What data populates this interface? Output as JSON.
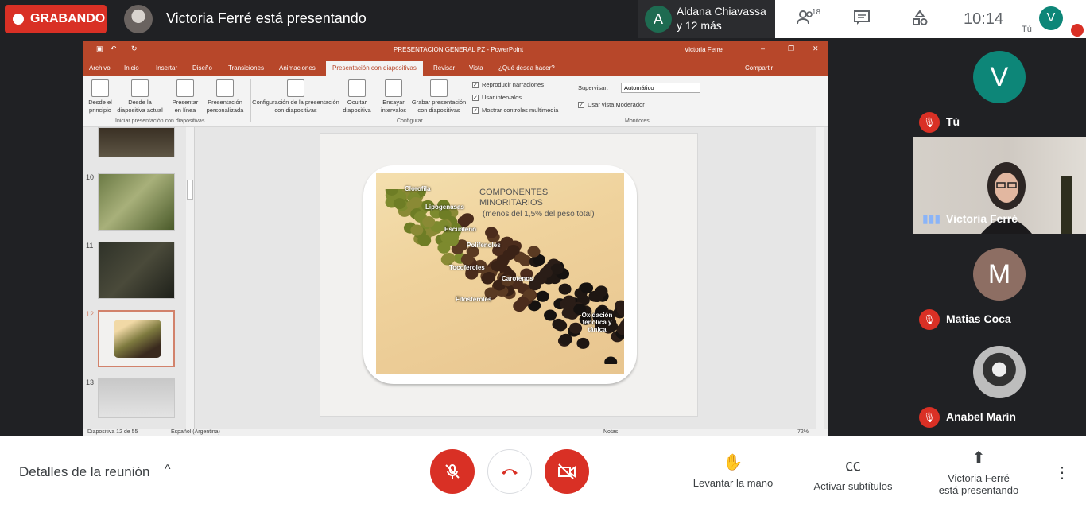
{
  "topbar": {
    "recording_label": "GRABANDO",
    "presenter_text": "Victoria Ferré está presentando",
    "others_avatar": "A",
    "others_line1": "Aldana Chiavassa",
    "others_line2": "y 12 más",
    "participants_count": "18",
    "time": "10:14",
    "me_avatar": "V",
    "me_label": "Tú"
  },
  "powerpoint": {
    "title": "PRESENTACION GENERAL PZ - PowerPoint",
    "user": "Victoria Ferre",
    "tabs": [
      "Archivo",
      "Inicio",
      "Insertar",
      "Diseño",
      "Transiciones",
      "Animaciones",
      "Presentación con diapositivas",
      "Revisar",
      "Vista",
      "¿Qué desea hacer?"
    ],
    "share": "Compartir",
    "ribbon": {
      "btn1": "Desde el principio",
      "btn2": "Desde la diapositiva actual",
      "btn3": "Presentar en línea",
      "btn4": "Presentación personalizada",
      "group1": "Iniciar presentación con diapositivas",
      "btn5": "Configuración de la presentación con diapositivas",
      "btn6": "Ocultar diapositiva",
      "btn7": "Ensayar intervalos",
      "btn8": "Grabar presentación con diapositivas",
      "chk1": "Reproducir narraciones",
      "chk2": "Usar intervalos",
      "chk3": "Mostrar controles multimedia",
      "group2": "Configurar",
      "supervisar_label": "Supervisar:",
      "supervisar_value": "Automático",
      "chk4": "Usar vista Moderador",
      "group3": "Monitores"
    },
    "thumb_numbers": [
      "10",
      "11",
      "12",
      "13"
    ],
    "slide": {
      "title": "COMPONENTES MINORITARIOS",
      "subtitle": "(menos del 1,5% del peso total)",
      "labels": [
        "Clorofila",
        "Lipogenasas",
        "Escualeno",
        "Polifenoles",
        "Tocoferoles",
        "Carotenos",
        "Fitosteroles",
        "Oxidación fenólica y tánica"
      ]
    },
    "status": {
      "slide_counter": "Diapositiva 12 de 55",
      "language": "Español (Argentina)",
      "notes": "Notas",
      "zoom": "72%"
    }
  },
  "participants": [
    {
      "initial": "V",
      "name": "Tú",
      "color": "#0d8678"
    },
    {
      "initial": "",
      "name": "Victoria Ferré",
      "color": ""
    },
    {
      "initial": "M",
      "name": "Matias Coca",
      "color": "#8d6e63"
    },
    {
      "initial": "",
      "name": "Anabel Marín",
      "color": "#9e9e9e"
    }
  ],
  "bottom": {
    "details": "Detalles de la reunión",
    "raise_hand": "Levantar la mano",
    "captions": "Activar subtítulos",
    "presenting_line1": "Victoria Ferré",
    "presenting_line2": "está presentando"
  }
}
